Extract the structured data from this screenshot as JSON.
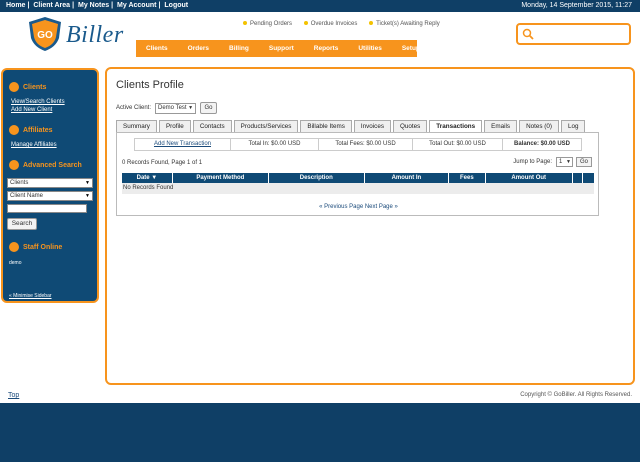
{
  "topbar": {
    "links": [
      "Home",
      "Client Area",
      "My Notes",
      "My Account",
      "Logout"
    ],
    "date": "Monday, 14 September 2015, 11:27"
  },
  "brand": {
    "logo_badge": "GO",
    "logo_text": "Biller"
  },
  "notices": [
    "Pending Orders",
    "Overdue Invoices",
    "Ticket(s) Awaiting Reply"
  ],
  "nav": [
    "Clients",
    "Orders",
    "Billing",
    "Support",
    "Reports",
    "Utilities",
    "Setup"
  ],
  "sidebar": {
    "clients_title": "Clients",
    "view_search_clients": "View/Search Clients",
    "add_new_client": "Add New Client",
    "affiliates_title": "Affiliates",
    "manage_affiliates": "Manage Affiliates",
    "advanced_search_title": "Advanced Search",
    "search_type": "Clients",
    "search_field": "Client Name",
    "search_button": "Search",
    "staff_online_title": "Staff Online",
    "staff_online_user": "demo",
    "minimise": "« Minimise Sidebar"
  },
  "page": {
    "title": "Clients Profile",
    "active_client_label": "Active Client:",
    "active_client_value": "Demo Test",
    "go_button": "Go"
  },
  "tabs": [
    "Summary",
    "Profile",
    "Contacts",
    "Products/Services",
    "Billable Items",
    "Invoices",
    "Quotes",
    "Transactions",
    "Emails",
    "Notes (0)",
    "Log"
  ],
  "totals": {
    "add_transaction": "Add New Transaction",
    "total_in": "Total In: $0.00 USD",
    "total_fees": "Total Fees: $0.00 USD",
    "total_out": "Total Out: $0.00 USD",
    "balance": "Balance: $0.00 USD"
  },
  "records": {
    "summary": "0 Records Found, Page 1 of 1",
    "jump_label": "Jump to Page:",
    "jump_value": "1",
    "jump_go": "Go"
  },
  "table": {
    "columns": [
      "Date ▼",
      "Payment Method",
      "Description",
      "Amount In",
      "Fees",
      "Amount Out",
      "",
      ""
    ],
    "empty": "No Records Found"
  },
  "pager": {
    "prev": "« Previous Page",
    "next": "Next Page »"
  },
  "footer": {
    "top": "Top",
    "copyright": "Copyright © GoBiller. All Rights Reserved."
  },
  "colors": {
    "navy": "#0f3f66",
    "orange": "#f7941d",
    "accent_yellow": "#f3c200"
  }
}
